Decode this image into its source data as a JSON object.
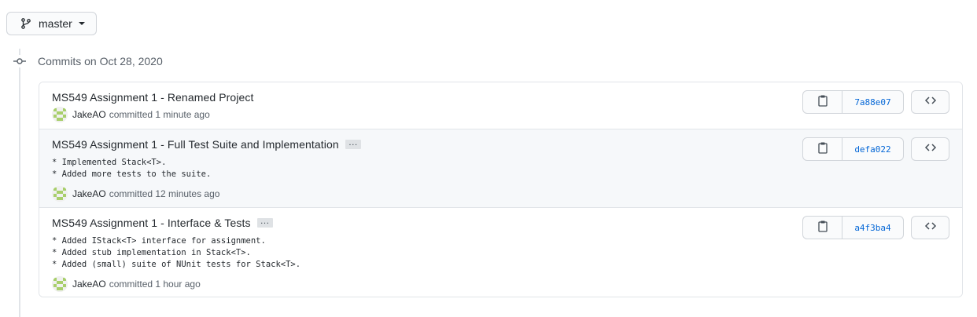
{
  "branch": {
    "name": "master"
  },
  "group": {
    "heading": "Commits on Oct 28, 2020"
  },
  "commits": [
    {
      "title": "MS549 Assignment 1 - Renamed Project",
      "author": "JakeAO",
      "committed_text": "committed 1 minute ago",
      "sha": "7a88e07"
    },
    {
      "title": "MS549 Assignment 1 - Full Test Suite and Implementation",
      "expand_label": "…",
      "body": "* Implemented Stack<T>.\n* Added more tests to the suite.",
      "author": "JakeAO",
      "committed_text": "committed 12 minutes ago",
      "sha": "defa022"
    },
    {
      "title": "MS549 Assignment 1 - Interface & Tests",
      "expand_label": "…",
      "body": "* Added IStack<T> interface for assignment.\n* Added stub implementation in Stack<T>.\n* Added (small) suite of NUnit tests for Stack<T>.",
      "author": "JakeAO",
      "committed_text": "committed 1 hour ago",
      "sha": "a4f3ba4"
    }
  ],
  "icons": {
    "branch": "git-branch-icon",
    "commit_node": "git-commit-icon",
    "copy": "clipboard-icon",
    "browse": "code-icon",
    "avatar": "identicon"
  },
  "colors": {
    "link": "#0366d6",
    "border": "#e1e4e8",
    "row_alt_bg": "#f6f8fa",
    "avatar_green": "#a8cf6b"
  }
}
